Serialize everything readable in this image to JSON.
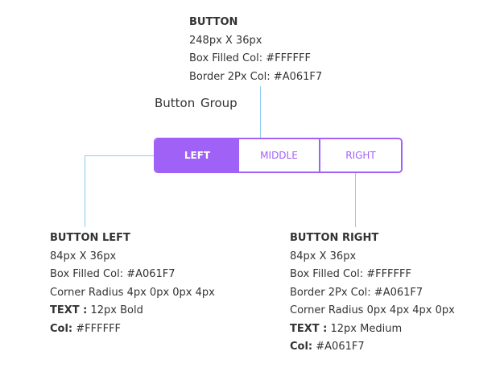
{
  "top_annotation": {
    "title": "BUTTON",
    "line1": "248px X 36px",
    "line2": "Box Filled Col: #FFFFFF",
    "line3": "Border 2Px Col: #A061F7"
  },
  "group_label": "Button  Group",
  "buttons": {
    "left": "LEFT",
    "middle": "MIDDLE",
    "right": "RIGHT"
  },
  "left_annotation": {
    "title": "BUTTON LEFT",
    "line1": "84px X 36px",
    "line2": "Box Filled Col: #A061F7",
    "line3": "Corner Radius 4px 0px 0px 4px",
    "text_label": "TEXT :",
    "text_value": " 12px Bold",
    "col_label": "Col:",
    "col_value": " #FFFFFF"
  },
  "right_annotation": {
    "title": "BUTTON RIGHT",
    "line1": "84px X 36px",
    "line2": "Box Filled Col: #FFFFFF",
    "line3": "Border 2Px Col: #A061F7",
    "line4": "Corner Radius 0px 4px 4px 0px",
    "text_label": "TEXT :",
    "text_value": " 12px Medium",
    "col_label": "Col:",
    "col_value": " #A061F7"
  },
  "colors": {
    "accent": "#A061F7",
    "fill": "#FFFFFF",
    "connector": "#8ecbf0"
  }
}
